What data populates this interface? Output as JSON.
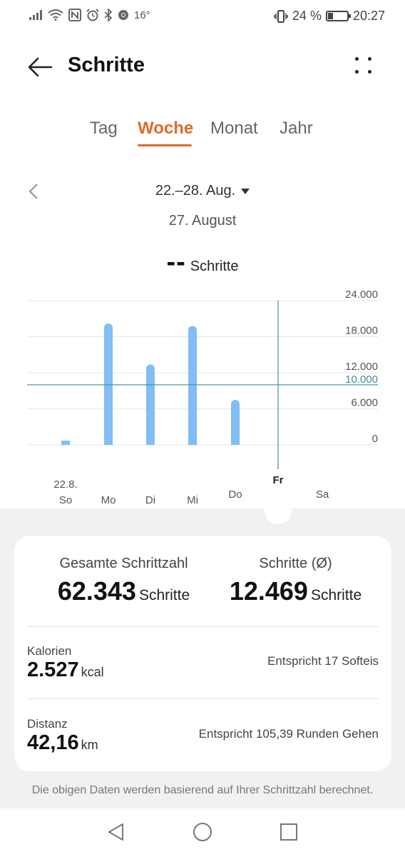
{
  "status_bar": {
    "temperature": "16°",
    "battery": "24 %",
    "battery_level": 0.24,
    "time": "20:27"
  },
  "header": {
    "title": "Schritte"
  },
  "tabs": [
    {
      "label": "Tag",
      "active": false
    },
    {
      "label": "Woche",
      "active": true
    },
    {
      "label": "Monat",
      "active": false
    },
    {
      "label": "Jahr",
      "active": false
    }
  ],
  "range": {
    "label": "22.–28. Aug.",
    "selected_date": "27. August"
  },
  "selection_summary": {
    "value": "--",
    "unit": "Schritte"
  },
  "chart_data": {
    "type": "bar",
    "categories": [
      "So",
      "Mo",
      "Di",
      "Mi",
      "Do",
      "Fr",
      "Sa"
    ],
    "first_date_label": "22.8.",
    "values": [
      500,
      20200,
      13400,
      19800,
      7500,
      null,
      null
    ],
    "ylim": [
      0,
      24000
    ],
    "yticks": [
      "0",
      "6.000",
      "12.000",
      "18.000",
      "24.000"
    ],
    "ytick_values": [
      0,
      6000,
      12000,
      18000,
      24000
    ],
    "goal_line": {
      "value": 10000,
      "label": "10.000"
    },
    "selected_category": "Fr",
    "colors": {
      "bar": "#82bdf5",
      "goal": "#3f8fa0",
      "grid": "#e6e6e6",
      "cursor": "#3f8fa0"
    }
  },
  "stats": {
    "total_label": "Gesamte Schrittzahl",
    "total_value": "62.343",
    "avg_label": "Schritte (Ø)",
    "avg_value": "12.469",
    "unit": "Schritte"
  },
  "details": [
    {
      "label": "Kalorien",
      "value": "2.527",
      "unit": "kcal",
      "equivalent": "Entspricht 17 Softeis"
    },
    {
      "label": "Distanz",
      "value": "42,16",
      "unit": "km",
      "equivalent": "Entspricht 105,39 Runden Gehen"
    }
  ],
  "footnote": "Die obigen Daten werden basierend auf Ihrer Schrittzahl berechnet.",
  "colors": {
    "accent": "#e06a2a",
    "background_sheet": "#f1f1f1"
  }
}
